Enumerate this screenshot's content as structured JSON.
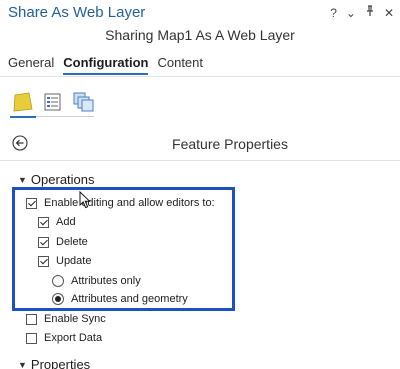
{
  "pane": {
    "title": "Share As Web Layer",
    "subtitle": "Sharing Map1 As A Web Layer",
    "controls": [
      "?",
      "⌄",
      "⊣",
      "✕"
    ]
  },
  "tabs": [
    "General",
    "Configuration",
    "Content"
  ],
  "active_tab": "Configuration",
  "icon_tabs": [
    "layer-icon",
    "properties-list-icon",
    "pages-icon"
  ],
  "feature_properties": {
    "title": "Feature Properties",
    "operations": {
      "header": "Operations",
      "enable_editing": "Enable editing and allow editors to:",
      "add": "Add",
      "delete": "Delete",
      "update": "Update",
      "attributes_only": "Attributes only",
      "attributes_and_geometry": "Attributes and geometry",
      "enable_sync": "Enable Sync",
      "export_data": "Export Data"
    },
    "properties": {
      "header": "Properties"
    }
  },
  "colors": {
    "title": "#1f5f9e",
    "highlight": "#1f4fc4",
    "tab_accent": "#2a6fba"
  }
}
